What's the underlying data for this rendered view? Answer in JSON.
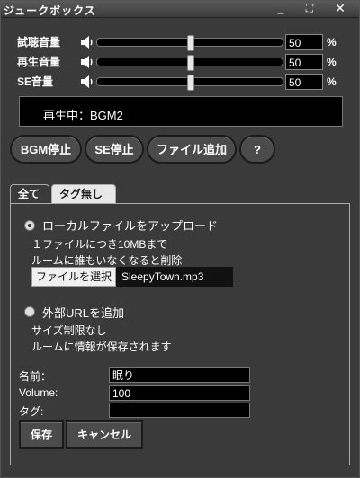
{
  "window": {
    "title": "ジュークボックス",
    "min_label": "_",
    "max_label": "⛶",
    "close_label": "✕"
  },
  "volumes": [
    {
      "label": "試聴音量",
      "value": "50",
      "unit": "%",
      "level": 0.5
    },
    {
      "label": "再生音量",
      "value": "50",
      "unit": "%",
      "level": 0.5
    },
    {
      "label": "SE音量",
      "value": "50",
      "unit": "%",
      "level": 0.5
    }
  ],
  "now_playing": "再生中：BGM2",
  "buttons": {
    "stop_bgm": "BGM停止",
    "stop_se": "SE停止",
    "add_file": "ファイル追加",
    "help": "?"
  },
  "tabs": [
    {
      "label": "全て"
    },
    {
      "label": "タグ無し"
    }
  ],
  "upload": {
    "option_label": "ローカルファイルをアップロード",
    "note1": "１ファイルにつき10MBまで",
    "note2": "ルームに誰もいなくなると削除",
    "choose_label": "ファイルを選択",
    "filename": "SleepyTown.mp3"
  },
  "url": {
    "option_label": "外部URLを追加",
    "note1": "サイズ制限なし",
    "note2": "ルームに情報が保存されます"
  },
  "form": {
    "name_label": "名前：",
    "name_value": "眠り",
    "volume_label": "Volume:",
    "volume_value": "100",
    "tag_label": "タグ:",
    "tag_value": ""
  },
  "actions": {
    "save": "保存",
    "cancel": "キャンセル"
  }
}
